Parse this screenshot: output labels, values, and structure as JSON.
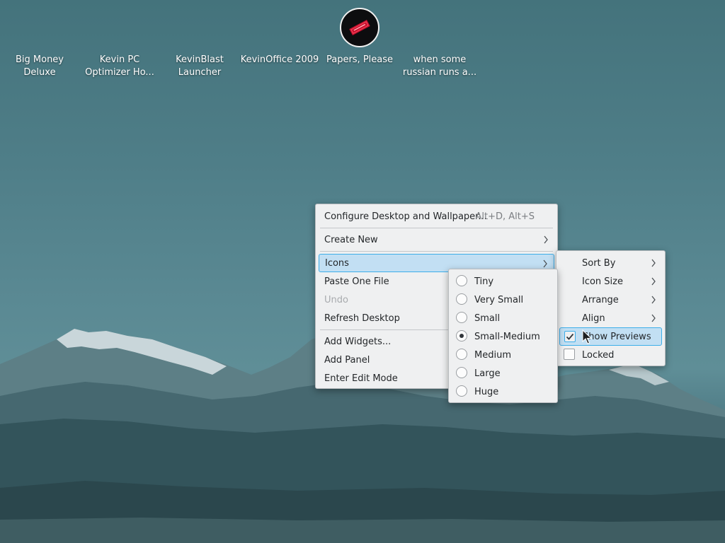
{
  "desktop_icons": [
    {
      "label": "Big Money Deluxe"
    },
    {
      "label": "Kevin PC Optimizer Ho..."
    },
    {
      "label": "KevinBlast Launcher"
    },
    {
      "label": "KevinOffice 2009"
    },
    {
      "label": "Papers, Please"
    },
    {
      "label": "when some russian runs a..."
    }
  ],
  "context_menu": {
    "items": [
      {
        "label": "Configure Desktop and Wallpaper...",
        "shortcut": "Alt+D, Alt+S"
      },
      {
        "label": "Create New"
      },
      {
        "label": "Icons"
      },
      {
        "label": "Paste One File"
      },
      {
        "label": "Undo"
      },
      {
        "label": "Refresh Desktop"
      },
      {
        "label": "Add Widgets..."
      },
      {
        "label": "Add Panel"
      },
      {
        "label": "Enter Edit Mode"
      }
    ]
  },
  "icon_size_menu": {
    "options": [
      "Tiny",
      "Very Small",
      "Small",
      "Small-Medium",
      "Medium",
      "Large",
      "Huge"
    ],
    "selected": "Small-Medium"
  },
  "icons_menu": {
    "items": [
      {
        "label": "Sort By"
      },
      {
        "label": "Icon Size"
      },
      {
        "label": "Arrange"
      },
      {
        "label": "Align"
      },
      {
        "label": "Show Previews",
        "checked": true
      },
      {
        "label": "Locked",
        "checked": false
      }
    ]
  },
  "colors": {
    "menu_bg": "#eff0f1",
    "highlight_bg": "#c2dff3",
    "highlight_border": "#3daee9",
    "text": "#232629",
    "disabled_text": "#a8abae"
  }
}
